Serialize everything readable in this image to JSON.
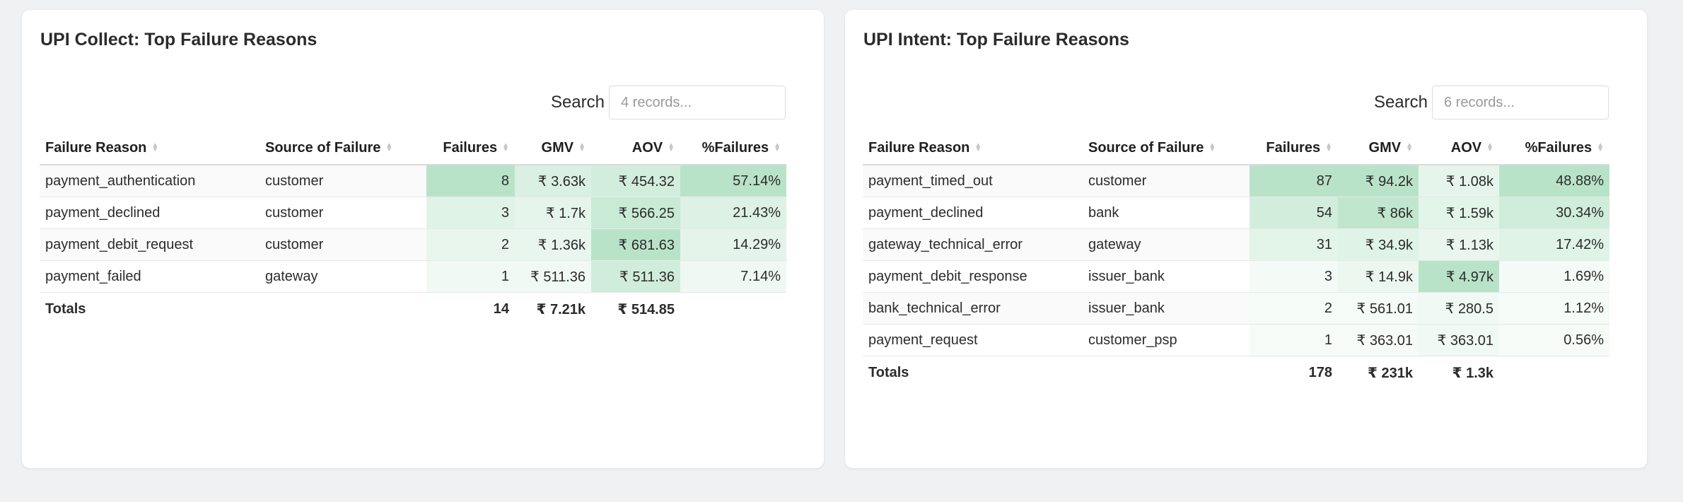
{
  "colors": {
    "heat_base": "#b6e2c6",
    "page_bg": "#f0f1f3"
  },
  "collect": {
    "title": "UPI Collect: Top Failure Reasons",
    "search_label": "Search",
    "search_placeholder": "4 records...",
    "columns": [
      "Failure Reason",
      "Source of Failure",
      "Failures",
      "GMV",
      "AOV",
      "%Failures"
    ],
    "rows": [
      {
        "reason": "payment_authentication",
        "source": "customer",
        "failures": "8",
        "gmv": "₹ 3.63k",
        "aov": "₹ 454.32",
        "pct": "57.14%"
      },
      {
        "reason": "payment_declined",
        "source": "customer",
        "failures": "3",
        "gmv": "₹ 1.7k",
        "aov": "₹ 566.25",
        "pct": "21.43%"
      },
      {
        "reason": "payment_debit_request",
        "source": "customer",
        "failures": "2",
        "gmv": "₹ 1.36k",
        "aov": "₹ 681.63",
        "pct": "14.29%"
      },
      {
        "reason": "payment_failed",
        "source": "gateway",
        "failures": "1",
        "gmv": "₹ 511.36",
        "aov": "₹ 511.36",
        "pct": "7.14%"
      }
    ],
    "heat": [
      [
        0.95,
        0.45,
        0.55,
        0.95
      ],
      [
        0.35,
        0.25,
        0.7,
        0.4
      ],
      [
        0.2,
        0.2,
        0.95,
        0.28
      ],
      [
        0.1,
        0.08,
        0.6,
        0.12
      ]
    ],
    "totals": {
      "label": "Totals",
      "failures": "14",
      "gmv": "₹ 7.21k",
      "aov": "₹ 514.85"
    }
  },
  "intent": {
    "title": "UPI Intent: Top Failure Reasons",
    "search_label": "Search",
    "search_placeholder": "6 records...",
    "columns": [
      "Failure Reason",
      "Source of Failure",
      "Failures",
      "GMV",
      "AOV",
      "%Failures"
    ],
    "rows": [
      {
        "reason": "payment_timed_out",
        "source": "customer",
        "failures": "87",
        "gmv": "₹ 94.2k",
        "aov": "₹ 1.08k",
        "pct": "48.88%"
      },
      {
        "reason": "payment_declined",
        "source": "bank",
        "failures": "54",
        "gmv": "₹ 86k",
        "aov": "₹ 1.59k",
        "pct": "30.34%"
      },
      {
        "reason": "gateway_technical_error",
        "source": "gateway",
        "failures": "31",
        "gmv": "₹ 34.9k",
        "aov": "₹ 1.13k",
        "pct": "17.42%"
      },
      {
        "reason": "payment_debit_response",
        "source": "issuer_bank",
        "failures": "3",
        "gmv": "₹ 14.9k",
        "aov": "₹ 4.97k",
        "pct": "1.69%"
      },
      {
        "reason": "bank_technical_error",
        "source": "issuer_bank",
        "failures": "2",
        "gmv": "₹ 561.01",
        "aov": "₹ 280.5",
        "pct": "1.12%"
      },
      {
        "reason": "payment_request",
        "source": "customer_psp",
        "failures": "1",
        "gmv": "₹ 363.01",
        "aov": "₹ 363.01",
        "pct": "0.56%"
      }
    ],
    "heat": [
      [
        0.95,
        0.95,
        0.25,
        0.95
      ],
      [
        0.55,
        0.85,
        0.3,
        0.6
      ],
      [
        0.3,
        0.35,
        0.22,
        0.35
      ],
      [
        0.03,
        0.16,
        0.95,
        0.03
      ],
      [
        0.02,
        0.02,
        0.08,
        0.02
      ],
      [
        0.01,
        0.01,
        0.1,
        0.01
      ]
    ],
    "totals": {
      "label": "Totals",
      "failures": "178",
      "gmv": "₹ 231k",
      "aov": "₹ 1.3k"
    }
  }
}
